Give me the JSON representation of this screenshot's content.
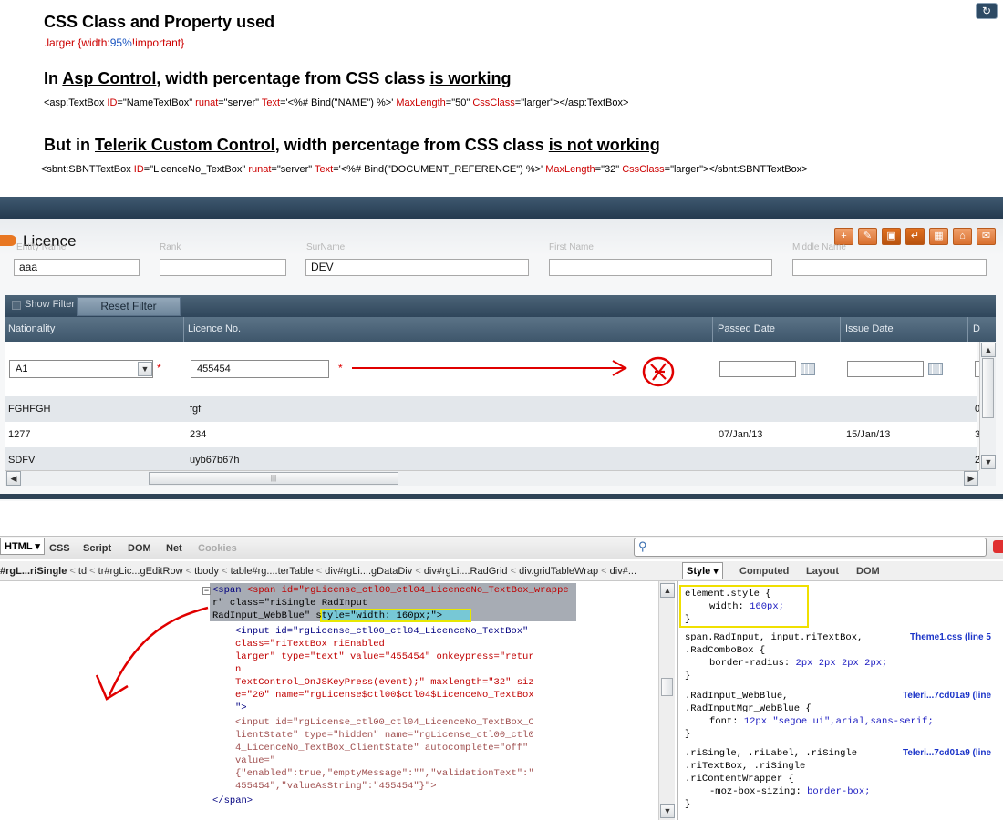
{
  "heading1": "CSS Class and Property used",
  "css_rule": {
    "selector": ".larger",
    "open": " {",
    "prop": "width",
    "colon": ":",
    "value": "95%",
    "important": "!important",
    "close": "}"
  },
  "heading2": {
    "prefix": "In ",
    "u1": "Asp Control",
    "mid": ", width percentage from CSS class ",
    "u2": "is working "
  },
  "asp_code": {
    "p1": "<asp:TextBox ",
    "a1": "ID",
    "v1": "=\"NameTextBox\" ",
    "a2": "runat",
    "v2": "=\"server\" ",
    "a3": "Text",
    "v3": "='<%# Bind(\"NAME\") %>' ",
    "a4": "MaxLength",
    "v4": "=\"50\" ",
    "a5": "CssClass",
    "v5": "=\"larger\"></asp:TextBox>"
  },
  "heading3": {
    "prefix": "But in ",
    "u1": "Telerik Custom Control",
    "mid": ", width percentage from CSS class ",
    "u2": "is not working"
  },
  "sbnt_code": {
    "p1": "<sbnt:SBNTTextBox ",
    "a1": "ID",
    "v1": "=\"LicenceNo_TextBox\" ",
    "a2": "runat",
    "v2": "=\"server\" ",
    "a3": "Text",
    "v3": "='<%# Bind(\"DOCUMENT_REFERENCE\") %>' ",
    "a4": "MaxLength",
    "v4": "=\"32\" ",
    "a5": "CssClass",
    "v5": "=\"larger\"></sbnt:SBNTTextBox>"
  },
  "app": {
    "title": "Licence",
    "refresh_icon": "↻",
    "toolbar_icons": [
      "add-icon",
      "edit-icon",
      "save-icon",
      "import-icon",
      "image-icon",
      "building-icon",
      "mail-icon"
    ],
    "field_labels": [
      "Entity Name",
      "Rank",
      "SurName",
      "First Name",
      "Middle Name"
    ],
    "field_values": [
      "aaa",
      "",
      "DEV",
      "",
      ""
    ],
    "show_filter": "Show Filter",
    "reset_filter": "Reset Filter",
    "columns": [
      "Nationality",
      "Licence No.",
      "Passed Date",
      "Issue Date",
      "D"
    ],
    "edit_row": {
      "nationality": "A1",
      "licence_no": "455454",
      "required": "*"
    },
    "rows": [
      {
        "nationality": "FGHFGH",
        "licence": "fgf",
        "passed": "",
        "issue": "",
        "d": "0"
      },
      {
        "nationality": "1277",
        "licence": "234",
        "passed": "07/Jan/13",
        "issue": "15/Jan/13",
        "d": "3"
      },
      {
        "nationality": "SDFV",
        "licence": "uyb67b67h",
        "passed": "",
        "issue": "",
        "d": "2"
      }
    ],
    "scroll_grip": "|||"
  },
  "firebug": {
    "tabs": [
      "HTML ▾",
      "CSS",
      "Script",
      "DOM",
      "Net",
      "Cookies"
    ],
    "breadcrumbs": [
      "#rgL...riSingle",
      "td",
      "tr#rgLic...gEditRow",
      "tbody",
      "table#rg....terTable",
      "div#rgLi....gDataDiv",
      "div#rgLi....RadGrid",
      "div.gridTableWrap",
      "div#..."
    ],
    "right_tabs": [
      "Style ▾",
      "Computed",
      "Layout",
      "DOM"
    ],
    "html_lines": [
      "<span id=\"rgLicense_ctl00_ctl04_LicenceNo_TextBox_wrappe",
      "r\" class=\"riSingle RadInput",
      "RadInput_WebBlue\" style=\"width: 160px;\">",
      "<input id=\"rgLicense_ctl00_ctl04_LicenceNo_TextBox\"",
      "class=\"riTextBox riEnabled",
      "larger\" type=\"text\" value=\"455454\" onkeypress=\"retur",
      "n",
      "TextControl_OnJSKeyPress(event);\" maxlength=\"32\" siz",
      "e=\"20\" name=\"rgLicense$ctl00$ctl04$LicenceNo_TextBox",
      "\">",
      "<input id=\"rgLicense_ctl00_ctl04_LicenceNo_TextBox_C",
      "lientState\" type=\"hidden\" name=\"rgLicense_ctl00_ctl0",
      "4_LicenceNo_TextBox_ClientState\" autocomplete=\"off\"",
      "value=\"",
      "{\"enabled\":true,\"emptyMessage\":\"\",\"validationText\":\"",
      "455454\",\"valueAsString\":\"455454\"}\">",
      "</span>"
    ],
    "style_rules": [
      {
        "selector": "element.style {",
        "props": [
          [
            "width",
            "160px;"
          ]
        ],
        "source": ""
      },
      {
        "selector": "span.RadInput, input.riTextBox,\n.RadComboBox {",
        "props": [
          [
            "border-radius",
            "2px 2px 2px 2px;"
          ]
        ],
        "source": "Theme1.css (line 5"
      },
      {
        "selector": ".RadInput_WebBlue,\n.RadInputMgr_WebBlue {",
        "props": [
          [
            "font",
            "12px \"segoe ui\",arial,sans-serif;"
          ]
        ],
        "source": "Teleri...7cd01a9 (line"
      },
      {
        "selector": ".riSingle, .riLabel, .riSingle\n.riTextBox, .riSingle\n.riContentWrapper {",
        "props": [
          [
            "-moz-box-sizing",
            "border-box;"
          ]
        ],
        "source": "Teleri...7cd01a9 (line"
      }
    ]
  },
  "colors": {
    "accent": "#e87722",
    "grid_header": "#4a6176",
    "annotation": "#e00000"
  }
}
